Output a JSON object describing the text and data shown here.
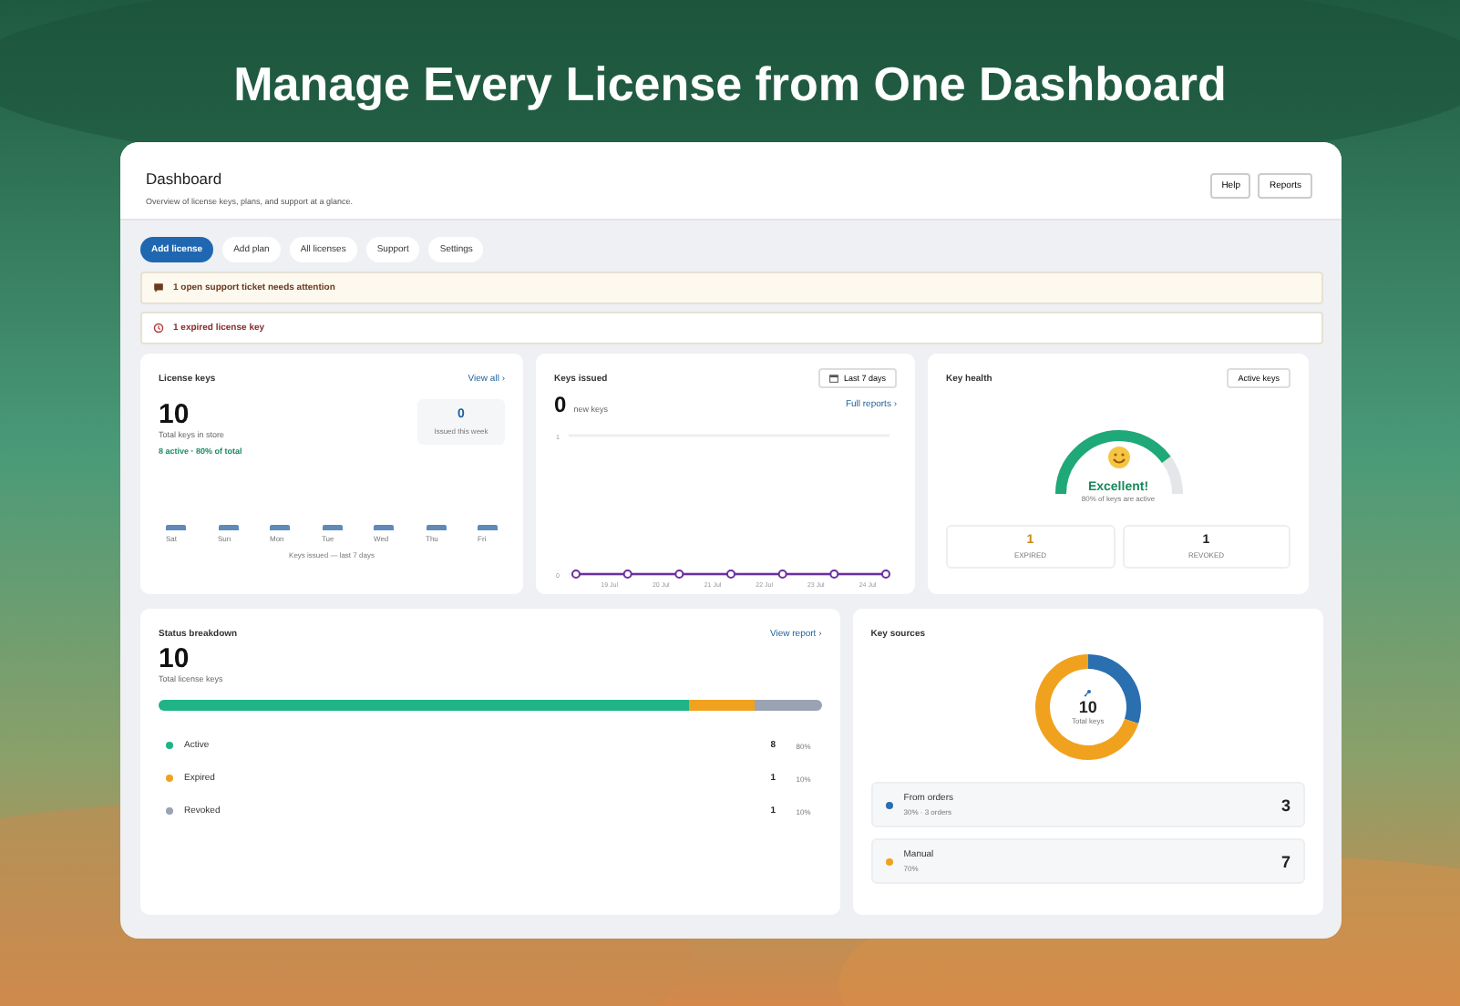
{
  "headline": "Manage Every License from One Dashboard",
  "header": {
    "title": "Dashboard",
    "subtitle": "Overview of license keys, plans, and support at a glance.",
    "buttons": [
      "Help",
      "Reports"
    ]
  },
  "tabs": [
    {
      "label": "Add license",
      "selected": true
    },
    {
      "label": "Add plan",
      "selected": false
    },
    {
      "label": "All licenses",
      "selected": false
    },
    {
      "label": "Support",
      "selected": false
    },
    {
      "label": "Settings",
      "selected": false
    }
  ],
  "alerts": [
    {
      "kind": "ticket",
      "text": "1 open support ticket needs attention"
    },
    {
      "kind": "expired",
      "text": "1 expired license key"
    }
  ],
  "license_keys": {
    "title": "License keys",
    "link": "View all ›",
    "total": "10",
    "total_label": "Total keys in store",
    "active_note": "8 active · 80% of total",
    "week_count": "0",
    "week_label": "Issued this week",
    "days": [
      "Sat",
      "Sun",
      "Mon",
      "Tue",
      "Wed",
      "Thu",
      "Fri"
    ],
    "caption": "Keys issued — last 7 days"
  },
  "keys_issued": {
    "title": "Keys issued",
    "range": "Last 7 days",
    "count": "0",
    "count_label": "new keys",
    "link": "Full reports ›",
    "chart_data": {
      "type": "line",
      "categories": [
        null,
        "19 Jul",
        "20 Jul",
        "21 Jul",
        "22 Jul",
        "23 Jul",
        "24 Jul"
      ],
      "series": [
        {
          "color": "#6b2fa0",
          "marker": "circle",
          "values": [
            0,
            0,
            0,
            0,
            0,
            0,
            0
          ]
        }
      ],
      "ylim": [
        0,
        1
      ],
      "yticks": [
        0,
        1
      ]
    }
  },
  "key_health": {
    "title": "Key health",
    "button": "Active keys",
    "rating": "Excellent!",
    "note": "80% of keys are active",
    "stats": [
      {
        "value": "1",
        "label": "EXPIRED",
        "color": "#c88a12"
      },
      {
        "value": "1",
        "label": "REVOKED",
        "color": "#222222"
      }
    ]
  },
  "status": {
    "title": "Status breakdown",
    "link": "View report ›",
    "total": "10",
    "total_label": "Total license keys",
    "items": [
      {
        "name": "Active",
        "count": "8",
        "percent": "80%",
        "color": "#1fb386"
      },
      {
        "name": "Expired",
        "count": "1",
        "percent": "10%",
        "color": "#f0a21e"
      },
      {
        "name": "Revoked",
        "count": "1",
        "percent": "10%",
        "color": "#9aa3b2"
      }
    ]
  },
  "sources": {
    "title": "Key sources",
    "total": "10",
    "total_label": "Total keys",
    "chart_data": {
      "type": "donut",
      "categories": [
        "From orders",
        "Manual"
      ],
      "values": [
        30,
        70
      ]
    },
    "items": [
      {
        "detail": "30% · 3 orders",
        "count": "3",
        "color": "#2a6fb0"
      },
      {
        "detail": "70%",
        "count": "7",
        "color": "#f0a21e"
      }
    ]
  }
}
